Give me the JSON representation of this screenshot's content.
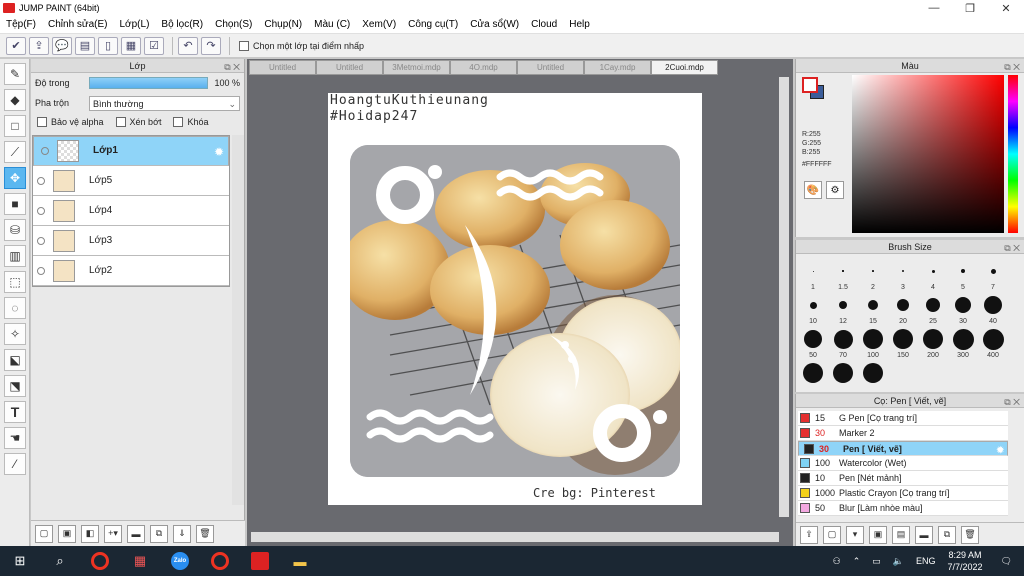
{
  "window": {
    "title": "JUMP PAINT (64bit)"
  },
  "menu": [
    "Tệp(F)",
    "Chỉnh sửa(E)",
    "Lớp(L)",
    "Bộ lọc(R)",
    "Chọn(S)",
    "Chụp(N)",
    "Màu (C)",
    "Xem(V)",
    "Công cụ(T)",
    "Cửa sổ(W)",
    "Cloud",
    "Help"
  ],
  "toolbar": {
    "pick_layer_label": "Chọn một lớp tại điểm nhấp"
  },
  "layer_panel": {
    "title": "Lớp",
    "opacity_label": "Độ trong",
    "opacity_value": "100 %",
    "opacity_fraction": 1.0,
    "blend_label": "Pha trộn",
    "blend_value": "Bình thường",
    "protect_alpha": "Bảo vệ alpha",
    "clipping": "Xén bớt",
    "lock": "Khóa",
    "layers": [
      "Lớp1",
      "Lớp5",
      "Lớp4",
      "Lớp3",
      "Lớp2"
    ],
    "selected": "Lớp1"
  },
  "tabs": [
    {
      "label": "Untitled",
      "active": false
    },
    {
      "label": "Untitled",
      "active": false
    },
    {
      "label": "3Metmoi.mdp",
      "active": false
    },
    {
      "label": "4O.mdp",
      "active": false
    },
    {
      "label": "Untitled",
      "active": false
    },
    {
      "label": "1Cay.mdp",
      "active": false
    },
    {
      "label": "2Cuoi.mdp",
      "active": true
    }
  ],
  "canvas": {
    "watermark_line1": "HoangtuKuthieunang",
    "watermark_line2": "#Hoidap247",
    "credit": "Cre bg: Pinterest"
  },
  "color_panel": {
    "title": "Màu",
    "r": "R:255",
    "g": "G:255",
    "b": "B:255",
    "hex": "#FFFFFF",
    "primary": "#ffffff",
    "secondary": "#3b5d9a"
  },
  "brush_panel": {
    "title": "Brush Size",
    "sizes": [
      "1",
      "1.5",
      "2",
      "3",
      "4",
      "5",
      "7",
      "10",
      "12",
      "15",
      "20",
      "25",
      "30",
      "40",
      "50",
      "70",
      "100",
      "150",
      "200",
      "300",
      "400",
      "",
      "",
      ""
    ]
  },
  "pen_panel": {
    "title": "Cọ: Pen [ Viết, vẽ]",
    "items": [
      {
        "size": "15",
        "name": "G Pen [Cọ trang trí]",
        "color": "#e53030"
      },
      {
        "size": "30",
        "name": "Marker 2",
        "color": "#e53030"
      },
      {
        "size": "30",
        "name": "Pen [ Viết, vẽ]",
        "color": "#222222"
      },
      {
        "size": "100",
        "name": "Watercolor (Wet)",
        "color": "#7fd3f5"
      },
      {
        "size": "10",
        "name": "Pen [Nét mảnh]",
        "color": "#222222"
      },
      {
        "size": "1000",
        "name": "Plastic Crayon [Cọ trang trí]",
        "color": "#f2d11b"
      },
      {
        "size": "50",
        "name": "Blur [Làm nhòe màu]",
        "color": "#f2a8e0"
      }
    ]
  },
  "taskbar": {
    "lang": "ENG",
    "time": "8:29 AM",
    "date": "7/7/2022",
    "zalo": "Zalo"
  }
}
